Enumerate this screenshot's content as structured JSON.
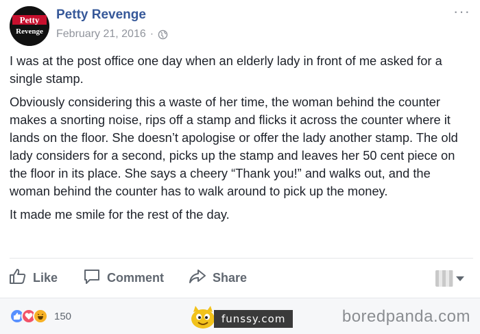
{
  "post": {
    "avatar_text_line1": "Petty",
    "avatar_text_line2": "Revenge",
    "page_name": "Petty Revenge",
    "date": "February 21, 2016",
    "separator": "·",
    "more_label": "···",
    "paragraphs": [
      "I was at the post office one day when an elderly lady in front of me asked for a single stamp.",
      "Obviously considering this a waste of her time, the woman behind the counter makes a snorting noise, rips off a stamp and flicks it across the counter where it lands on the floor. She doesn’t apologise or offer the lady another stamp. The old lady considers for a second, picks up the stamp and leaves her 50 cent piece on the floor in its place. She says a cheery “Thank you!” and walks out, and the woman behind the counter has to walk around to pick up the money.",
      "It made me smile for the rest of the day."
    ]
  },
  "actions": {
    "like": "Like",
    "comment": "Comment",
    "share": "Share"
  },
  "footer": {
    "reaction_count": "150",
    "funssy_label": "funssy.com",
    "watermark": "boredpanda.com"
  },
  "colors": {
    "link_blue": "#365899",
    "muted": "#90949c",
    "action_gray": "#606770",
    "like_blue": "#5890ff",
    "love_red": "#f25268",
    "haha_yellow": "#f7b125"
  },
  "icons": [
    "globe-icon",
    "like-thumb-icon",
    "comment-bubble-icon",
    "share-arrow-icon",
    "caret-down-icon"
  ]
}
